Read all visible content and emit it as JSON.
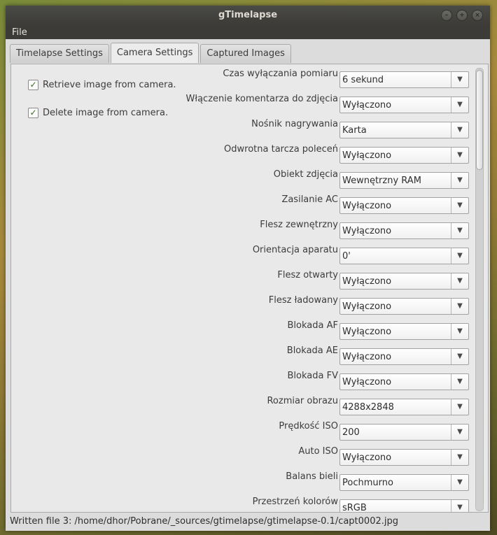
{
  "window": {
    "title": "gTimelapse"
  },
  "menubar": {
    "file": "File"
  },
  "tabs": [
    "Timelapse Settings",
    "Camera Settings",
    "Captured Images"
  ],
  "active_tab": "Camera Settings",
  "checkboxes": [
    {
      "label": "Retrieve image from camera.",
      "checked": true
    },
    {
      "label": "Delete image from camera.",
      "checked": true
    }
  ],
  "settings": [
    {
      "label": "Czas wyłączania pomiaru",
      "value": "6 sekund"
    },
    {
      "label": "Włączenie komentarza do zdjęcia",
      "value": "Wyłączono"
    },
    {
      "label": "Nośnik nagrywania",
      "value": "Karta"
    },
    {
      "label": "Odwrotna tarcza poleceń",
      "value": "Wyłączono"
    },
    {
      "label": "Obiekt zdjęcia",
      "value": "Wewnętrzny RAM"
    },
    {
      "label": "Zasilanie AC",
      "value": "Wyłączono"
    },
    {
      "label": "Flesz zewnętrzny",
      "value": "Wyłączono"
    },
    {
      "label": "Orientacja aparatu",
      "value": "0'"
    },
    {
      "label": "Flesz otwarty",
      "value": "Wyłączono"
    },
    {
      "label": "Flesz ładowany",
      "value": "Wyłączono"
    },
    {
      "label": "Blokada AF",
      "value": "Wyłączono"
    },
    {
      "label": "Blokada AE",
      "value": "Wyłączono"
    },
    {
      "label": "Blokada FV",
      "value": "Wyłączono"
    },
    {
      "label": "Rozmiar obrazu",
      "value": "4288x2848"
    },
    {
      "label": "Prędkość ISO",
      "value": "200"
    },
    {
      "label": "Auto ISO",
      "value": "Wyłączono"
    },
    {
      "label": "Balans bieli",
      "value": "Pochmurno"
    },
    {
      "label": "Przestrzeń kolorów",
      "value": "sRGB"
    }
  ],
  "statusbar": {
    "text": "Written file 3: /home/dhor/Pobrane/_sources/gtimelapse/gtimelapse-0.1/capt0002.jpg"
  },
  "icons": {
    "dropdown": "chevron-down-icon",
    "check": "checkmark-icon"
  }
}
